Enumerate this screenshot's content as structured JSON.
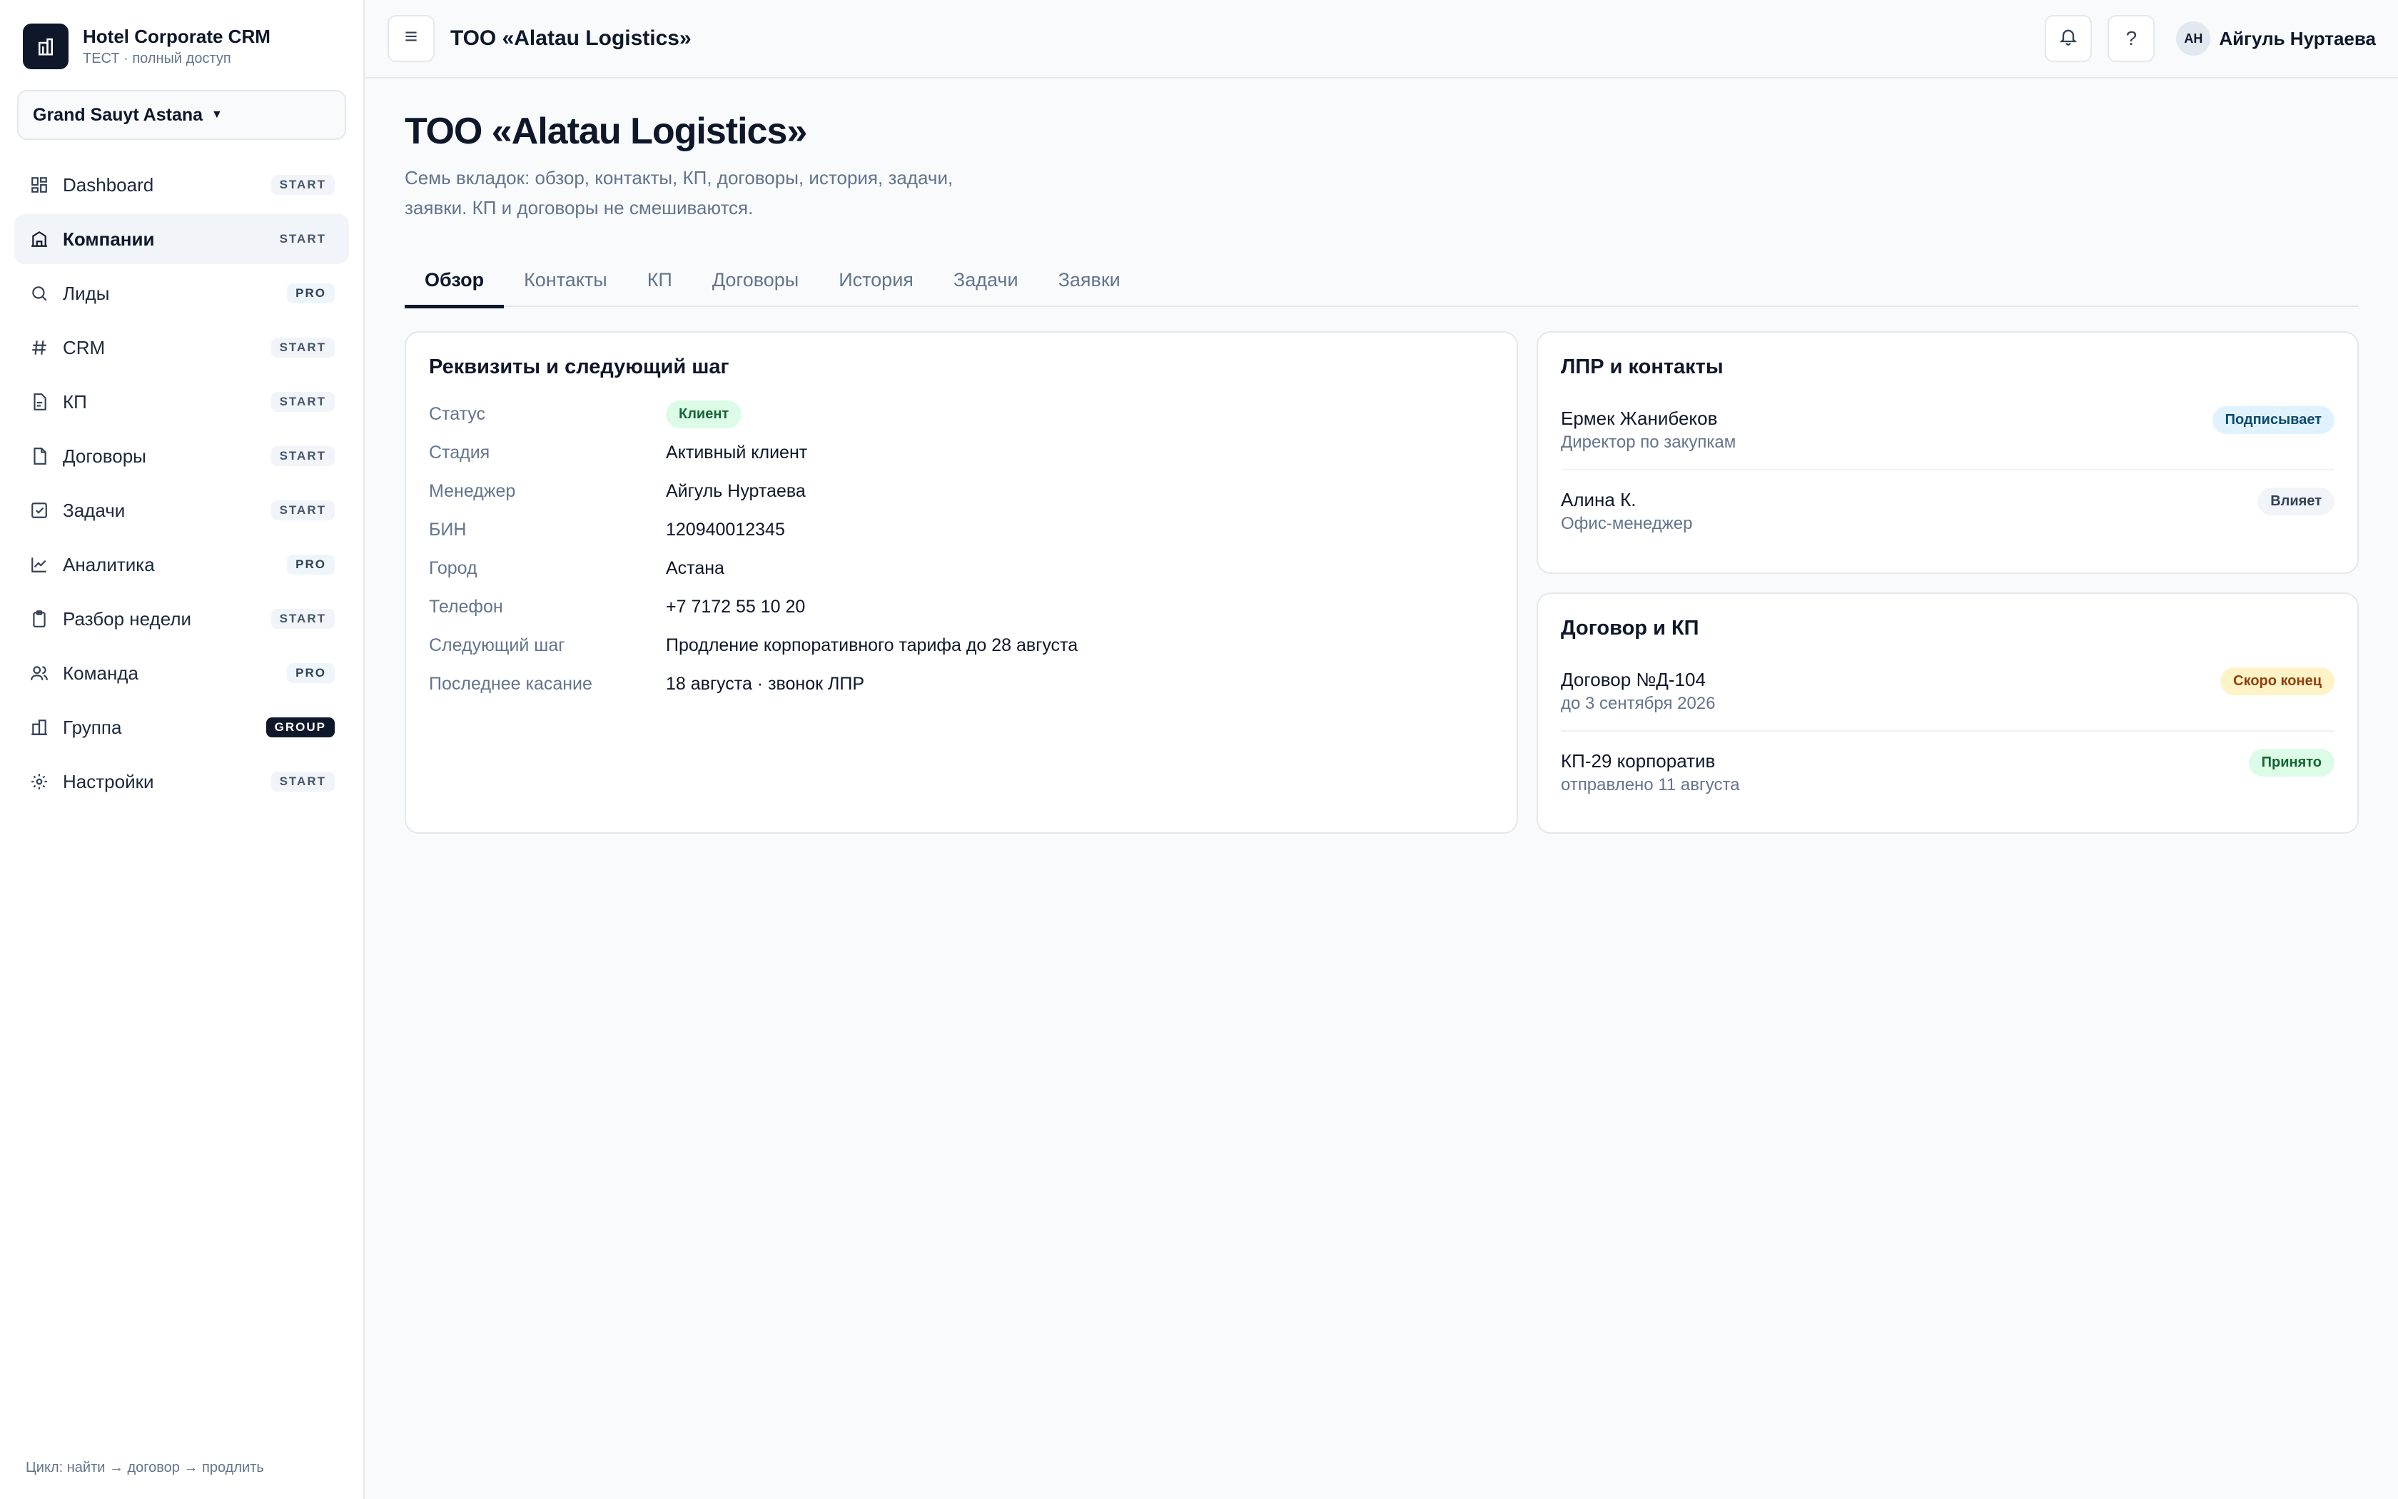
{
  "app": {
    "title": "Hotel Corporate CRM",
    "subtitle": "ТЕСТ · полный доступ"
  },
  "hotel_selector": {
    "value": "Grand Sauyt Astana"
  },
  "sidebar": {
    "items": [
      {
        "label": "Dashboard",
        "tier": "START",
        "icon": "dashboard-icon"
      },
      {
        "label": "Компании",
        "tier": "START",
        "icon": "building-icon",
        "active": true
      },
      {
        "label": "Лиды",
        "tier": "PRO",
        "icon": "search-icon"
      },
      {
        "label": "CRM",
        "tier": "START",
        "icon": "hash-icon"
      },
      {
        "label": "КП",
        "tier": "START",
        "icon": "document-icon"
      },
      {
        "label": "Договоры",
        "tier": "START",
        "icon": "file-icon"
      },
      {
        "label": "Задачи",
        "tier": "START",
        "icon": "checkbox-icon"
      },
      {
        "label": "Аналитика",
        "tier": "PRO",
        "icon": "chart-line-icon"
      },
      {
        "label": "Разбор недели",
        "tier": "START",
        "icon": "clipboard-icon"
      },
      {
        "label": "Команда",
        "tier": "PRO",
        "icon": "users-icon"
      },
      {
        "label": "Группа",
        "tier": "GROUP",
        "icon": "buildings-icon"
      },
      {
        "label": "Настройки",
        "tier": "START",
        "icon": "sun-gear-icon"
      }
    ],
    "footer": "Цикл: найти → договор → продлить"
  },
  "topbar": {
    "title": "ТОО «Alatau Logistics»",
    "help": "?",
    "user": {
      "initials": "АН",
      "name": "Айгуль Нуртаева"
    }
  },
  "page": {
    "title": "ТОО «Alatau Logistics»",
    "description": "Семь вкладок: обзор, контакты, КП, договоры, история, задачи, заявки. КП и договоры не смешиваются."
  },
  "tabs": [
    {
      "label": "Обзор",
      "active": true
    },
    {
      "label": "Контакты"
    },
    {
      "label": "КП"
    },
    {
      "label": "Договоры"
    },
    {
      "label": "История"
    },
    {
      "label": "Задачи"
    },
    {
      "label": "Заявки"
    }
  ],
  "details": {
    "title": "Реквизиты и следующий шаг",
    "status": {
      "label": "Статус",
      "value": "Клиент"
    },
    "rows": [
      {
        "label": "Стадия",
        "value": "Активный клиент"
      },
      {
        "label": "Менеджер",
        "value": "Айгуль Нуртаева"
      },
      {
        "label": "БИН",
        "value": "120940012345"
      },
      {
        "label": "Город",
        "value": "Астана"
      },
      {
        "label": "Телефон",
        "value": "+7 7172 55 10 20"
      },
      {
        "label": "Следующий шаг",
        "value": "Продление корпоративного тарифа до 28 августа"
      },
      {
        "label": "Последнее касание",
        "value": "18 августа · звонок ЛПР"
      }
    ]
  },
  "contacts": {
    "title": "ЛПР и контакты",
    "items": [
      {
        "name": "Ермек Жанибеков",
        "role": "Директор по закупкам",
        "badge": "Подписывает",
        "badge_color": "#e0f2fe"
      },
      {
        "name": "Алина К.",
        "role": "Офис-менеджер",
        "badge": "Влияет",
        "badge_color": "#f1f5f9"
      }
    ]
  },
  "contracts": {
    "title": "Договор и КП",
    "items": [
      {
        "name": "Договор №Д-104",
        "sub": "до 3 сентября 2026",
        "badge": "Скоро конец",
        "badge_color": "#fef3c7"
      },
      {
        "name": "КП-29 корпоратив",
        "sub": "отправлено 11 августа",
        "badge": "Принято",
        "badge_color": "#dcfce7"
      }
    ]
  }
}
